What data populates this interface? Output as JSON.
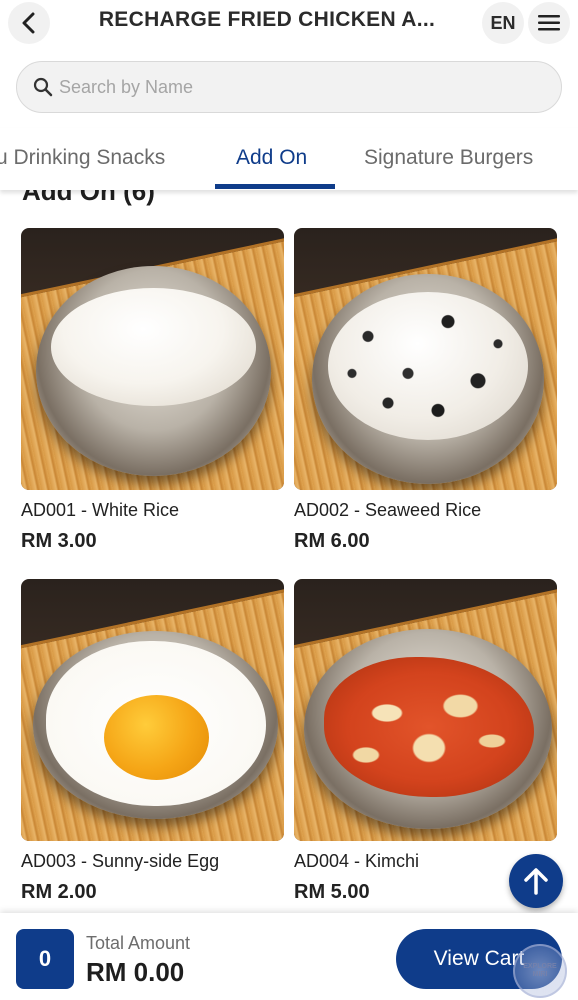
{
  "header": {
    "title": "RECHARGE FRIED CHICKEN A...",
    "language": "EN"
  },
  "search": {
    "placeholder": "Search by Name",
    "value": ""
  },
  "tabs": [
    {
      "label": "u Drinking Snacks",
      "active": false
    },
    {
      "label": "Add On",
      "active": true
    },
    {
      "label": "Signature Burgers",
      "active": false
    }
  ],
  "section": {
    "heading": "Add On (6)"
  },
  "items": [
    {
      "name": "AD001 - White Rice",
      "price": "RM 3.00",
      "image": "white-rice-bowl"
    },
    {
      "name": "AD002 - Seaweed Rice",
      "price": "RM 6.00",
      "image": "seaweed-rice-bowl"
    },
    {
      "name": "AD003 - Sunny-side Egg",
      "price": "RM 2.00",
      "image": "sunny-side-egg-plate"
    },
    {
      "name": "AD004 - Kimchi",
      "price": "RM 5.00",
      "image": "kimchi-bowl"
    }
  ],
  "cart": {
    "count": "0",
    "total_label": "Total Amount",
    "total_value": "RM 0.00",
    "view_cart_label": "View Cart"
  },
  "watermark": {
    "line1": "EXPLORE",
    "line2": "MIRI"
  },
  "colors": {
    "accent": "#0f3c8a",
    "background": "#ffffff",
    "text": "#1e1e1e",
    "muted": "#6d6d6d"
  },
  "icons": {
    "back": "chevron-left-icon",
    "menu": "hamburger-menu-icon",
    "search": "search-icon",
    "scroll_top": "arrow-up-icon"
  }
}
